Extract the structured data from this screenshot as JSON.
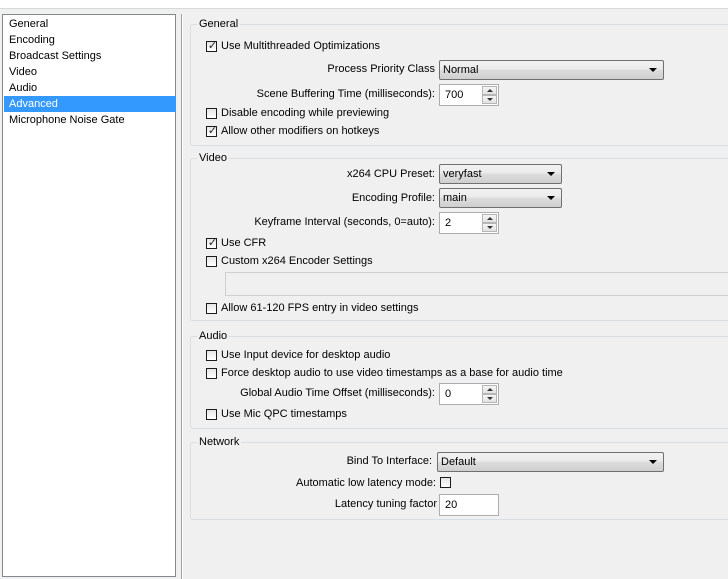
{
  "sidebar": {
    "items": [
      {
        "label": "General",
        "selected": false
      },
      {
        "label": "Encoding",
        "selected": false
      },
      {
        "label": "Broadcast Settings",
        "selected": false
      },
      {
        "label": "Video",
        "selected": false
      },
      {
        "label": "Audio",
        "selected": false
      },
      {
        "label": "Advanced",
        "selected": true
      },
      {
        "label": "Microphone Noise Gate",
        "selected": false
      }
    ]
  },
  "general": {
    "title": "General",
    "multithreaded": {
      "label": "Use Multithreaded Optimizations",
      "checked": true
    },
    "priority": {
      "label": "Process Priority Class",
      "value": "Normal"
    },
    "buffering": {
      "label": "Scene Buffering Time (milliseconds):",
      "value": "700"
    },
    "disable_encoding": {
      "label": "Disable encoding while previewing",
      "checked": false
    },
    "modifiers": {
      "label": "Allow other modifiers on hotkeys",
      "checked": true
    }
  },
  "video": {
    "title": "Video",
    "preset": {
      "label": "x264 CPU Preset:",
      "value": "veryfast"
    },
    "profile": {
      "label": "Encoding Profile:",
      "value": "main"
    },
    "keyframe": {
      "label": "Keyframe Interval (seconds, 0=auto):",
      "value": "2"
    },
    "cfr": {
      "label": "Use CFR",
      "checked": true
    },
    "custom_x264": {
      "label": "Custom x264 Encoder Settings",
      "checked": false,
      "value": ""
    },
    "fps_entry": {
      "label": "Allow 61-120 FPS entry in video settings",
      "checked": false
    }
  },
  "audio": {
    "title": "Audio",
    "input_device": {
      "label": "Use Input device for desktop audio",
      "checked": false
    },
    "force_timestamps": {
      "label": "Force desktop audio to use video timestamps as a base for audio time",
      "checked": false
    },
    "offset": {
      "label": "Global Audio Time Offset (milliseconds):",
      "value": "0"
    },
    "qpc": {
      "label": "Use Mic QPC timestamps",
      "checked": false
    }
  },
  "network": {
    "title": "Network",
    "bind": {
      "label": "Bind To Interface:",
      "value": "Default"
    },
    "low_latency": {
      "label": "Automatic low latency mode:",
      "checked": false
    },
    "latency_factor": {
      "label": "Latency tuning factor",
      "value": "20"
    }
  }
}
